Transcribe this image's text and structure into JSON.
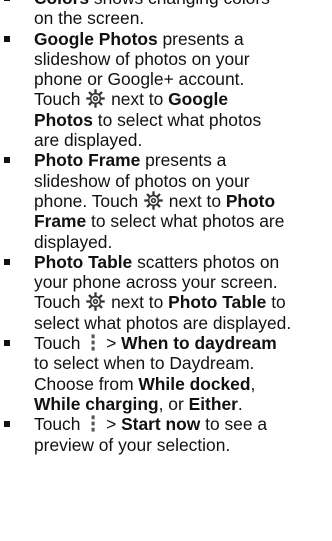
{
  "items": [
    {
      "line0": "Colors",
      "line0b": " shows changing colors",
      "line1": "on the screen."
    },
    {
      "l0": "Google Photos",
      "l0b": " presents a",
      "l1": "slideshow of photos on your",
      "l2": "phone or Google+ account.",
      "l3a": "Touch ",
      "l3b": " next to ",
      "l3c": "Google",
      "l4a": "Photos",
      "l4b": " to select what photos",
      "l5": "are displayed."
    },
    {
      "l0": "Photo Frame",
      "l0b": " presents a",
      "l1": "slideshow of photos on your",
      "l2a": "phone. Touch ",
      "l2b": " next to ",
      "l2c": "Photo",
      "l3a": "Frame",
      "l3b": " to select what photos are",
      "l4": "displayed."
    },
    {
      "l0": "Photo Table",
      "l0b": " scatters photos on",
      "l1": "your phone across your screen.",
      "l2a": "Touch ",
      "l2b": " next to ",
      "l2c": "Photo Table",
      "l2d": " to",
      "l3": "select what photos are displayed."
    },
    {
      "l0a": "Touch ",
      "l0b": " > ",
      "l0c": "When to daydream",
      "l1": "to select when to Daydream.",
      "l2a": "Choose from ",
      "l2b": "While docked",
      "l2c": ",",
      "l3a": "While charging",
      "l3b": ", or ",
      "l3c": "Either",
      "l3d": "."
    },
    {
      "l0a": "Touch ",
      "l0b": " > ",
      "l0c": "Start now",
      "l0d": " to see a",
      "l1": "preview of your selection."
    }
  ],
  "icons": {
    "settings": "gear-icon",
    "menu": "menu-icon"
  }
}
